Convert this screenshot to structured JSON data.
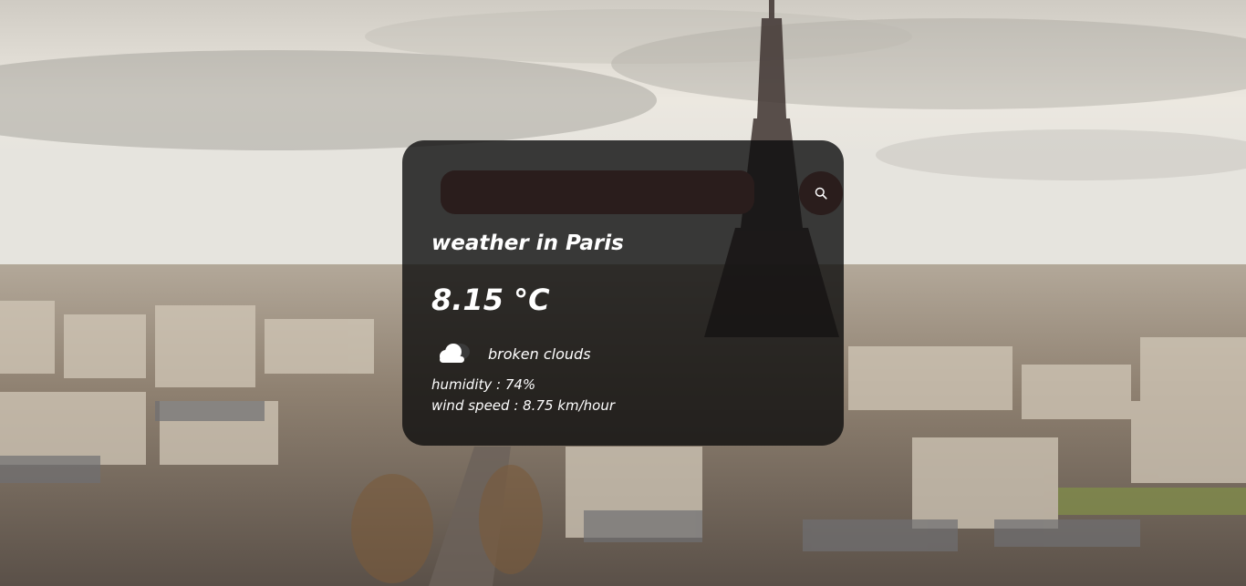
{
  "search": {
    "value": "",
    "placeholder": ""
  },
  "weather": {
    "title": "weather in Paris",
    "temperature": "8.15 °C",
    "condition": "broken clouds",
    "condition_icon": "cloud-icon",
    "humidity": "humidity : 74%",
    "wind_speed": "wind speed : 8.75 km/hour"
  },
  "icons": {
    "search_button_icon": "search-icon"
  },
  "colors": {
    "card_background": "#0c0c0c",
    "input_background": "#2a1d1c",
    "text": "#ffffff"
  }
}
